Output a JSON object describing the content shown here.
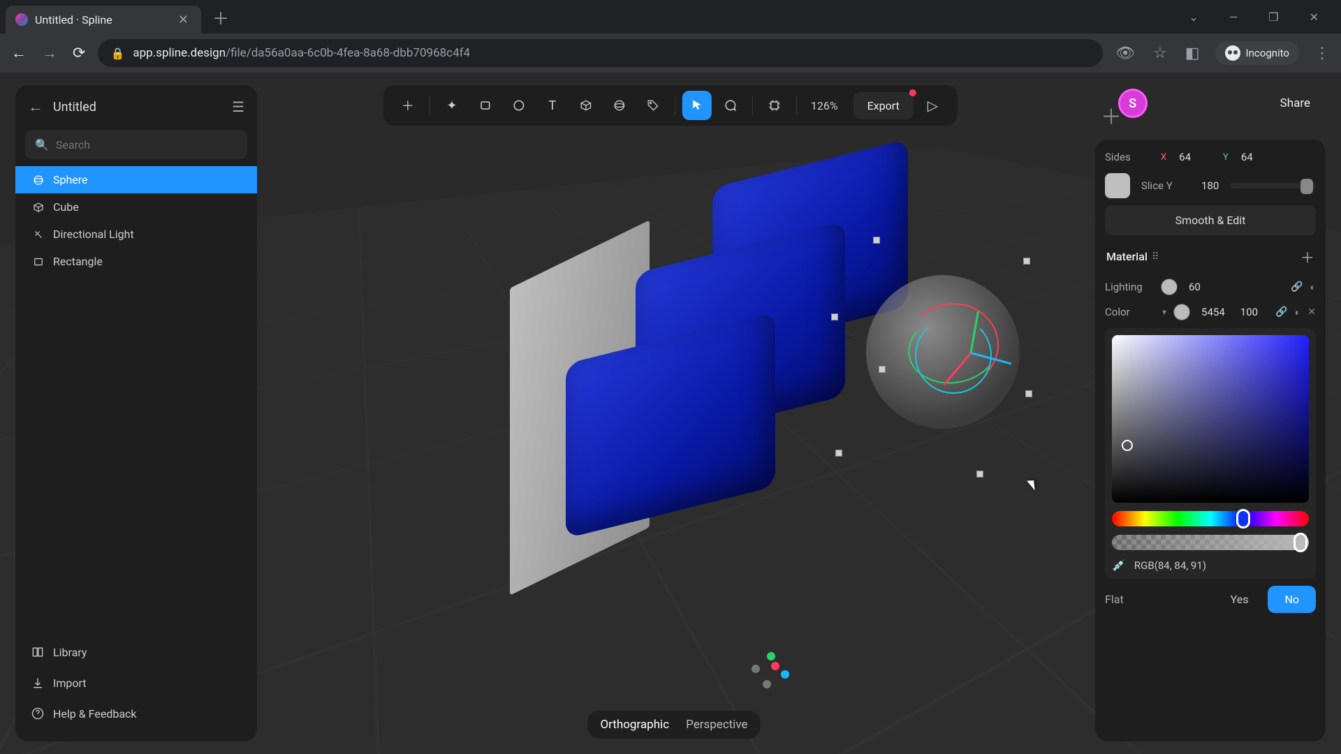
{
  "browser": {
    "tab_title": "Untitled · Spline",
    "url_domain": "app.spline.design",
    "url_path": "/file/da56a0aa-6c0b-4fea-8a68-dbb70968c4f4",
    "incognito_label": "Incognito"
  },
  "left_panel": {
    "doc_title": "Untitled",
    "search_placeholder": "Search",
    "layers": [
      {
        "name": "Sphere",
        "icon": "sphere",
        "selected": true
      },
      {
        "name": "Cube",
        "icon": "cube",
        "selected": false
      },
      {
        "name": "Directional Light",
        "icon": "light",
        "selected": false
      },
      {
        "name": "Rectangle",
        "icon": "rectangle",
        "selected": false
      }
    ],
    "footer": {
      "library": "Library",
      "import": "Import",
      "help": "Help & Feedback"
    }
  },
  "toolbar": {
    "zoom": "126%",
    "export": "Export"
  },
  "user": {
    "initial": "S",
    "share": "Share"
  },
  "right_panel": {
    "sides_label": "Sides",
    "sides_x": "64",
    "sides_y": "64",
    "slice_y_label": "Slice Y",
    "slice_y_value": "180",
    "smooth_edit": "Smooth & Edit",
    "material_label": "Material",
    "lighting_label": "Lighting",
    "lighting_value": "60",
    "color_label": "Color",
    "color_value1": "5454",
    "color_value2": "100",
    "rgb_text": "RGB(84, 84, 91)",
    "flat_label": "Flat",
    "flat_yes": "Yes",
    "flat_no": "No"
  },
  "camera": {
    "ortho": "Orthographic",
    "persp": "Perspective"
  }
}
